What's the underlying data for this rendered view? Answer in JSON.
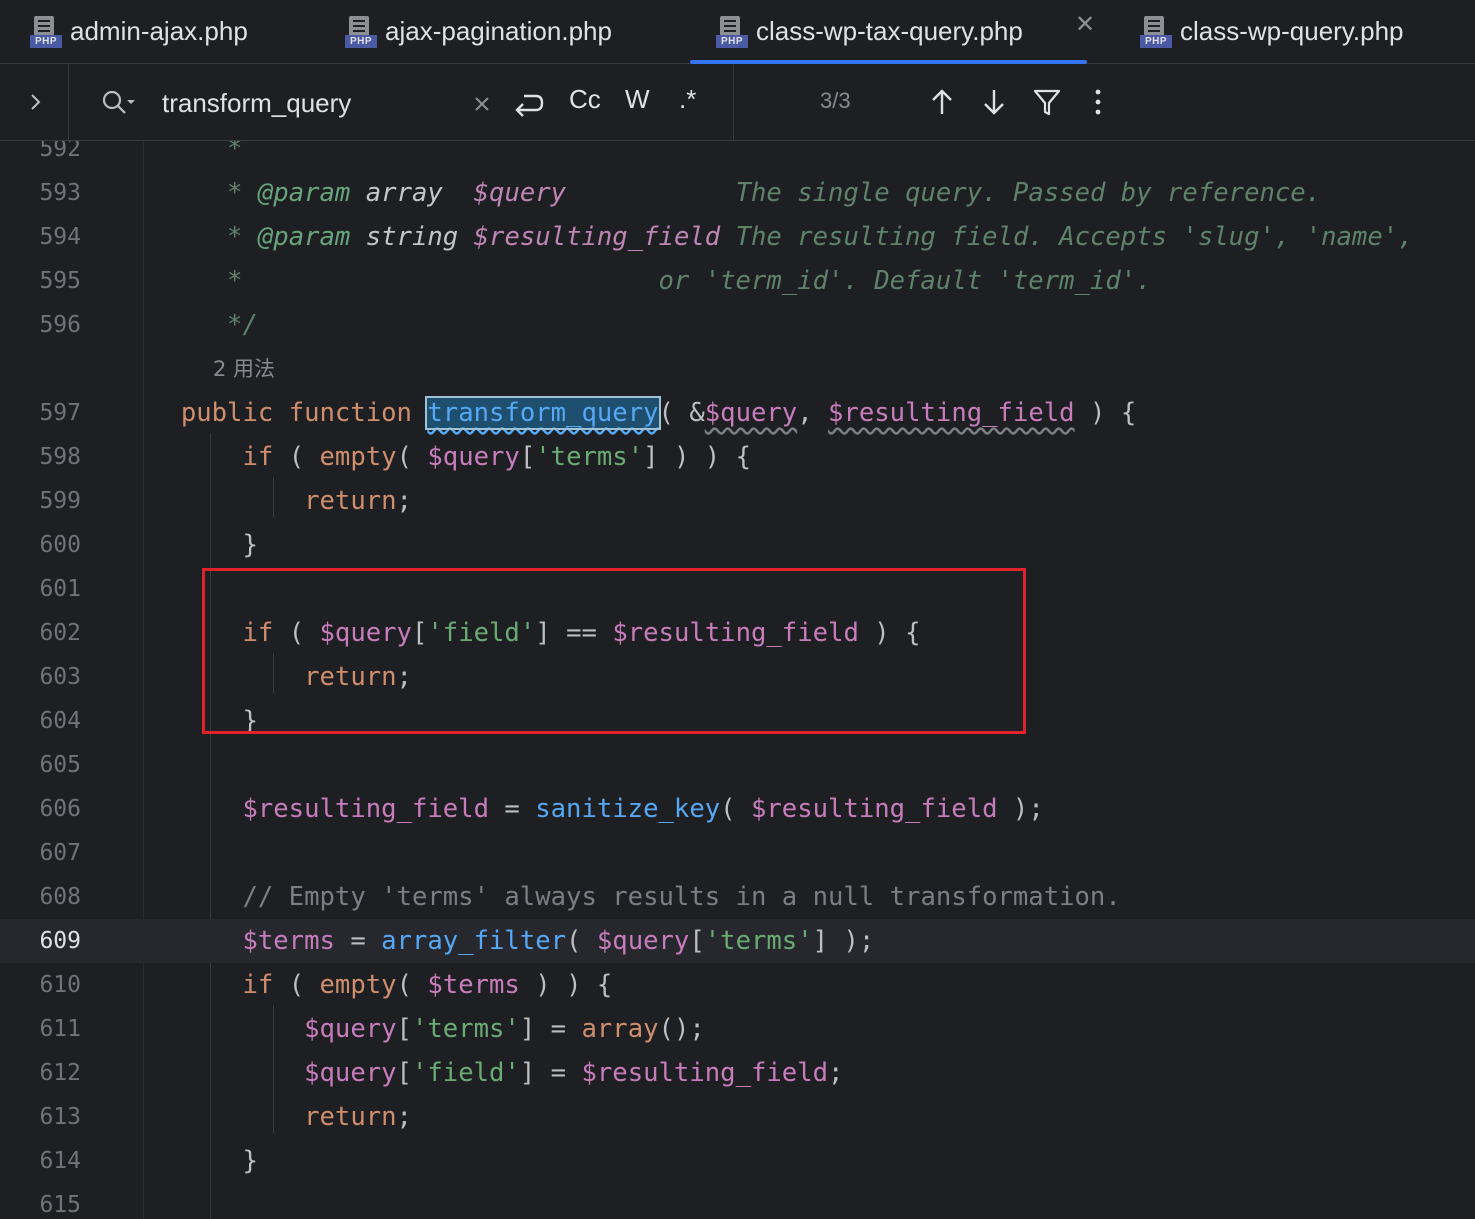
{
  "tabs": [
    {
      "label": "admin-ajax.php",
      "icon": "php-file-icon",
      "active": false
    },
    {
      "label": "ajax-pagination.php",
      "icon": "php-file-icon",
      "active": false
    },
    {
      "label": "class-wp-tax-query.php",
      "icon": "php-file-icon",
      "active": true
    },
    {
      "label": "class-wp-query.php",
      "icon": "php-file-icon",
      "active": false
    }
  ],
  "file_icon_label": "PHP",
  "search": {
    "value": "transform_query",
    "match_case_label": "Cc",
    "words_label": "W",
    "regex_label": ".*",
    "match_count": "3/3"
  },
  "editor": {
    "usages_hint": "2 用法",
    "line_numbers": [
      "592",
      "593",
      "594",
      "595",
      "596",
      "597",
      "598",
      "599",
      "600",
      "601",
      "602",
      "603",
      "604",
      "605",
      "606",
      "607",
      "608",
      "609",
      "610",
      "611",
      "612",
      "613",
      "614",
      "615"
    ],
    "current_line": "609"
  },
  "colors": {
    "background": "#1e1f22",
    "keyword": "#cf8e6d",
    "variable": "#c77dbb",
    "string": "#6aab73",
    "function": "#56a8f5",
    "highlight_box": "#e0222d",
    "active_tab_underline": "#3574f0"
  }
}
